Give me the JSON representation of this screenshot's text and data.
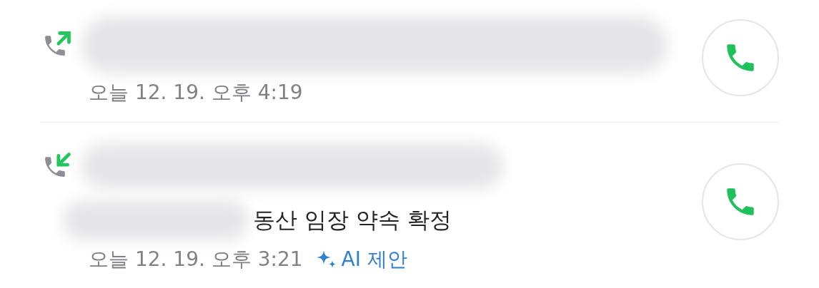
{
  "calls": [
    {
      "kind": "outgoing",
      "time": "오늘 12. 19. 오후 4:19"
    },
    {
      "kind": "incoming",
      "summary": "동산 임장 약속 확정",
      "time": "오늘 12. 19. 오후 3:21",
      "ai_label": "AI 제안"
    }
  ]
}
